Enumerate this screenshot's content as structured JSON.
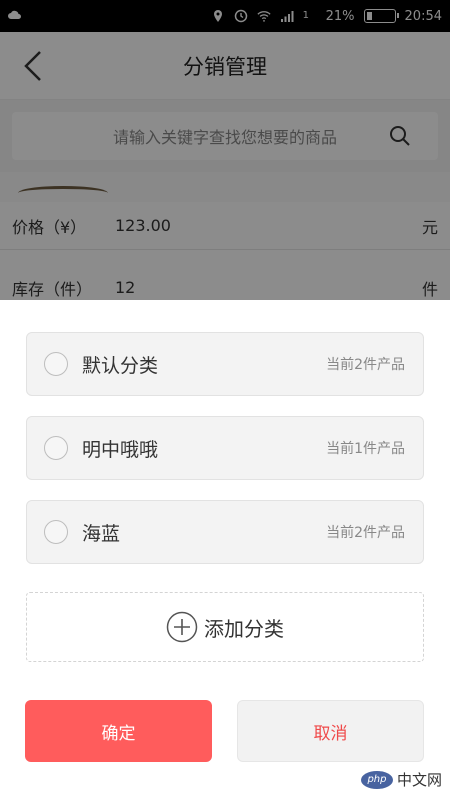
{
  "status_bar": {
    "battery": "21%",
    "battery_level": 0.21,
    "time": "20:54",
    "signal": "1"
  },
  "header": {
    "title": "分销管理"
  },
  "search": {
    "placeholder": "请输入关键字查找您想要的商品"
  },
  "form": {
    "price": {
      "label": "价格（¥）",
      "value": "123.00",
      "unit": "元"
    },
    "stock": {
      "label": "库存（件）",
      "value": "12",
      "unit": "件"
    }
  },
  "categories": [
    {
      "name": "默认分类",
      "count": "当前2件产品"
    },
    {
      "name": "明中哦哦",
      "count": "当前1件产品"
    },
    {
      "name": "海蓝",
      "count": "当前2件产品"
    }
  ],
  "add_category": {
    "label": "添加分类"
  },
  "buttons": {
    "confirm": "确定",
    "cancel": "取消"
  },
  "watermark": {
    "logo": "php",
    "text": "中文网"
  },
  "colors": {
    "primary": "#ff5c5c",
    "cancel_text": "#f04a4a",
    "overlay": "rgba(0,0,0,0.45)"
  }
}
